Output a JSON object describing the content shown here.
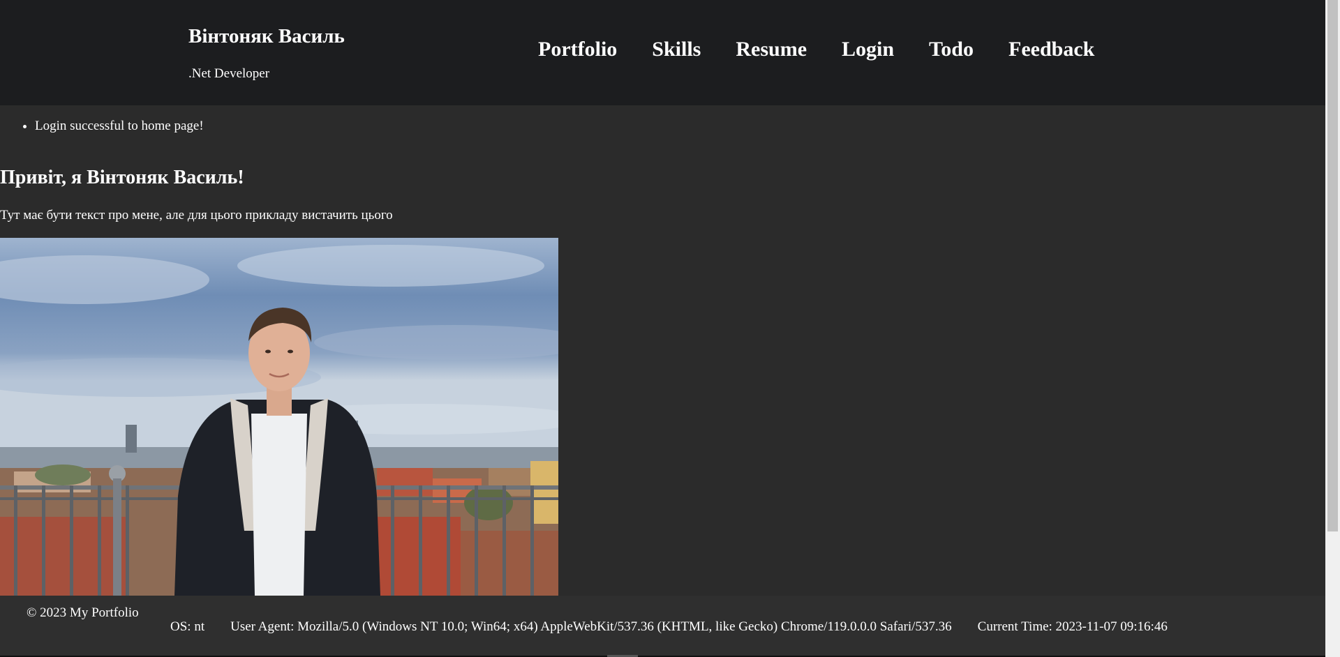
{
  "header": {
    "name": "Вінтоняк Василь",
    "role": ".Net Developer",
    "nav": [
      {
        "label": "Portfolio"
      },
      {
        "label": "Skills"
      },
      {
        "label": "Resume"
      },
      {
        "label": "Login"
      },
      {
        "label": "Todo"
      },
      {
        "label": "Feedback"
      }
    ]
  },
  "main": {
    "messages": [
      "Login successful to home page!"
    ],
    "greeting": "Привіт, я Вінтоняк Василь!",
    "about": "Тут має бути текст про мене, але для цього прикладу вистачить цього"
  },
  "footer": {
    "copyright": "© 2023 My Portfolio",
    "os": "OS: nt",
    "user_agent": "User Agent: Mozilla/5.0 (Windows NT 10.0; Win64; x64) AppleWebKit/537.36 (KHTML, like Gecko) Chrome/119.0.0.0 Safari/537.36",
    "current_time": "Current Time: 2023-11-07 09:16:46"
  },
  "colors": {
    "header_bg": "#1c1d1f",
    "page_bg": "#2b2b2b",
    "footer_bg": "#2f2f2f",
    "text": "#ffffff"
  }
}
